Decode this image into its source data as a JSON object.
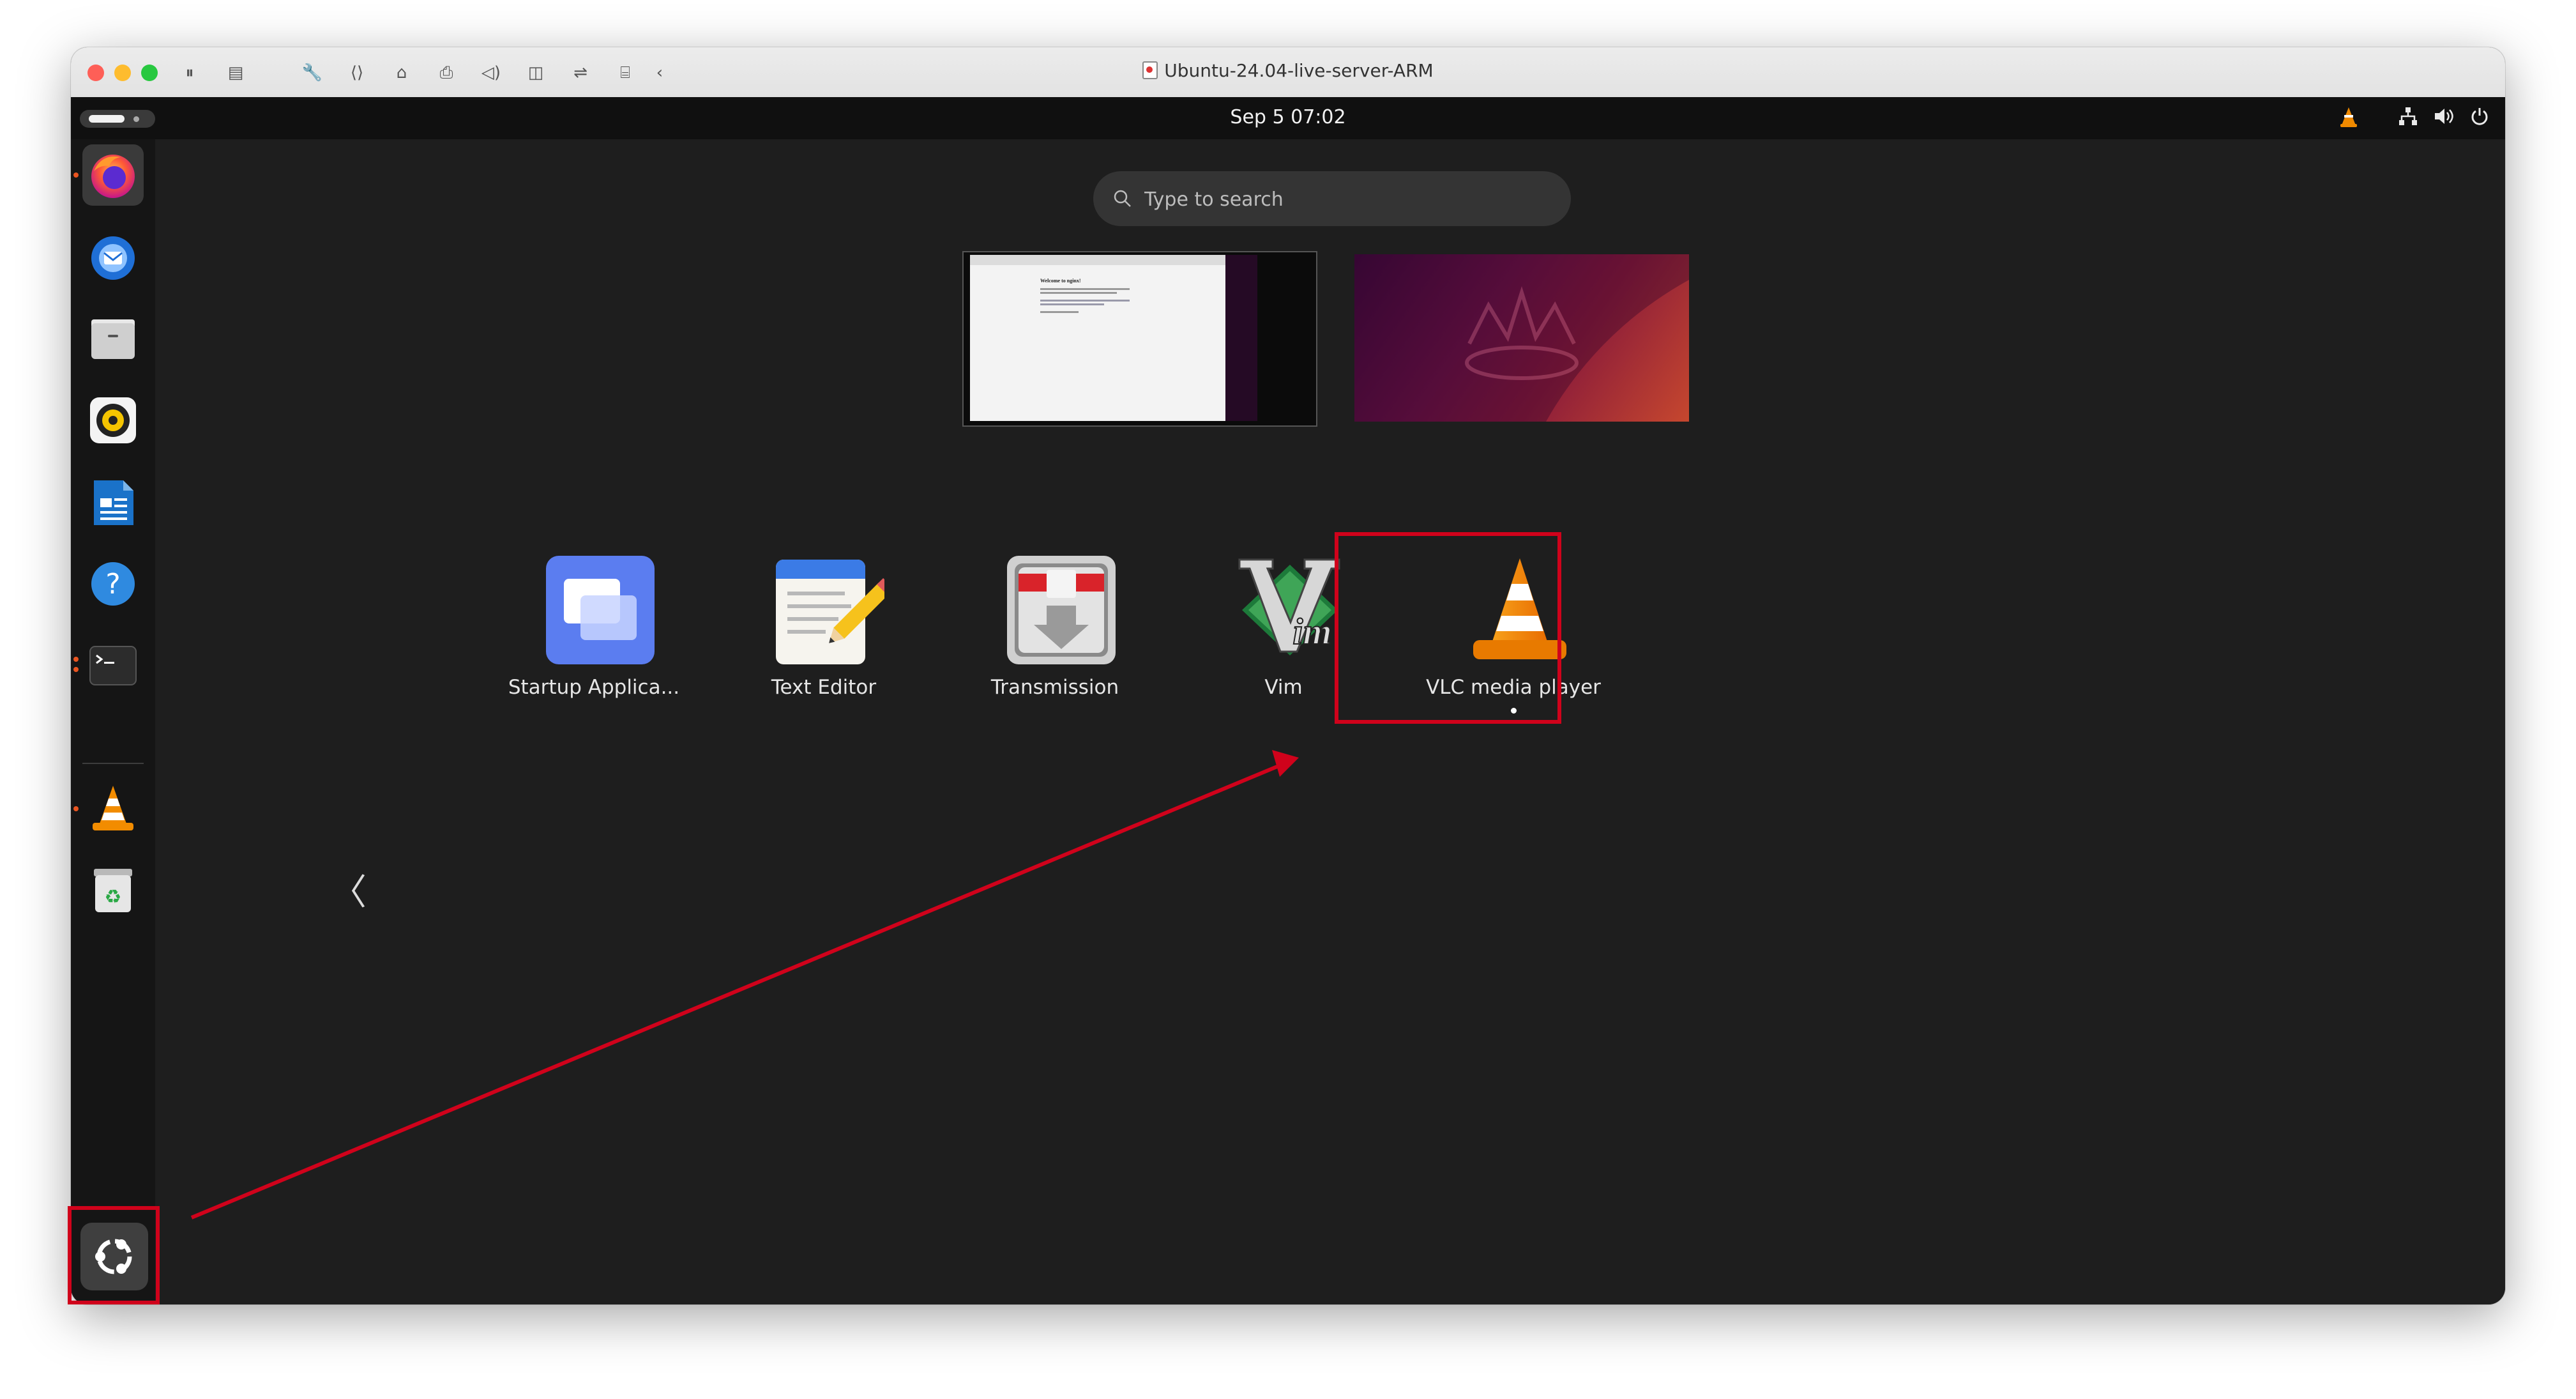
{
  "window": {
    "title": "Ubuntu-24.04-live-server-ARM"
  },
  "topbar": {
    "clock": "Sep 5  07:02"
  },
  "search": {
    "placeholder": "Type to search"
  },
  "workspace1": {
    "heading": "Welcome to nginx!"
  },
  "dock": {
    "items": [
      {
        "name": "Firefox",
        "running": true,
        "active": true
      },
      {
        "name": "Thunderbird",
        "running": false
      },
      {
        "name": "Files",
        "running": false
      },
      {
        "name": "Rhythmbox",
        "running": false
      },
      {
        "name": "LibreOffice Writer",
        "running": false
      },
      {
        "name": "Help",
        "running": false
      },
      {
        "name": "Terminal",
        "running": true
      },
      {
        "name": "VLC media player",
        "running": true
      },
      {
        "name": "Trash",
        "running": false
      }
    ]
  },
  "apps": [
    {
      "label": "Startup Applica...",
      "icon": "startup-applications-icon"
    },
    {
      "label": "Text Editor",
      "icon": "text-editor-icon"
    },
    {
      "label": "Transmission",
      "icon": "transmission-icon"
    },
    {
      "label": "Vim",
      "icon": "vim-icon"
    },
    {
      "label": "VLC media player",
      "icon": "vlc-icon",
      "running": true,
      "highlighted": true
    }
  ],
  "pager": {
    "pages": 2,
    "current": 2
  },
  "colors": {
    "annotation": "#d0021b",
    "ubuntu_orange": "#e95420",
    "desktop_bg": "#1e1e1e",
    "topbar_bg": "#101010"
  }
}
